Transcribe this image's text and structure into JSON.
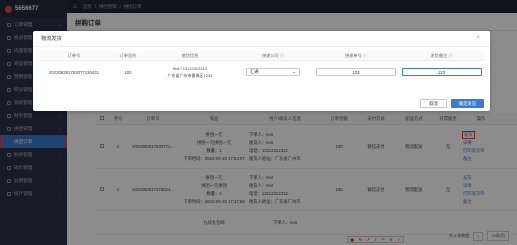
{
  "app": {
    "brand": "5656677"
  },
  "sidebar": {
    "items": [
      {
        "label": "订单管理"
      },
      {
        "label": "会员管理"
      },
      {
        "label": "内容管理"
      },
      {
        "label": "商品管理"
      },
      {
        "label": "营销管理"
      },
      {
        "label": "积分管理"
      },
      {
        "label": "系统管理"
      },
      {
        "label": "财务管理"
      },
      {
        "label": "拼团管理"
      },
      {
        "label": "拼团订单"
      },
      {
        "label": "秒杀管理"
      },
      {
        "label": "砍价管理"
      },
      {
        "label": "分销管理"
      },
      {
        "label": "统计管理"
      }
    ]
  },
  "header": {
    "crumbs": [
      "首页",
      "拼团营销",
      "拼团订单"
    ]
  },
  "page": {
    "title": "拼购订单"
  },
  "table": {
    "columns": [
      "序号",
      "订单号",
      "商品",
      "用户/收货人信息",
      "订单金额",
      "支付方式",
      "配送方式",
      "开票服务",
      "操作"
    ],
    "rows": [
      {
        "index": "1",
        "order_no": "2022092817530771...",
        "product": [
          "拼团一元",
          "拼团一元拼团一元",
          "数量：1",
          "下单时间：2022-09-28 17:53:07"
        ],
        "user": [
          "下单人：test",
          "收货人：test",
          "电话：13112312312",
          "收货人地址：广东省广州市"
        ],
        "amount": "100",
        "pay": "微信支付",
        "delivery": "物流配送",
        "invoice": "无",
        "ops": [
          "发货",
          "详情",
          "打印发货单",
          "备注"
        ]
      },
      {
        "index": "2",
        "order_no": "2022092817475524...",
        "product": [
          "拼团一元",
          "拼团一元拼团",
          "数量：1",
          "下单时间：2022-09-28 17:47:55"
        ],
        "user": [
          "下单人：test",
          "收货人：test",
          "电话：13112312312",
          "收货人地址：广东省广州市"
        ],
        "amount": "100",
        "pay": "微信支付",
        "delivery": "物流配送",
        "invoice": "无",
        "ops": [
          "发货",
          "详情",
          "打印发货单",
          "备注"
        ]
      },
      {
        "index": "3",
        "order_no": "",
        "product": [
          "九块九包邮"
        ],
        "user": [
          "下单人：test"
        ],
        "amount": "",
        "pay": "",
        "delivery": "",
        "invoice": "",
        "ops": []
      }
    ]
  },
  "pager": {
    "total": "共 4 条数据",
    "page": "1",
    "per_page": "10条/页"
  },
  "modal": {
    "title": "物流发货",
    "columns": [
      "订单号",
      "订单总价",
      "收货信息",
      "快递公司 ⓘ",
      "快递单号 ⓘ",
      "发货备注 ⓘ"
    ],
    "row": {
      "order_no": "202209281753077130431",
      "total": "100",
      "phone": "test / 13112312312",
      "address": "广东省广州市番禺区1234",
      "courier": "汇通",
      "tracking_no": "123",
      "note": "123"
    },
    "cancel_label": "取消",
    "confirm_label": "确定发货"
  }
}
